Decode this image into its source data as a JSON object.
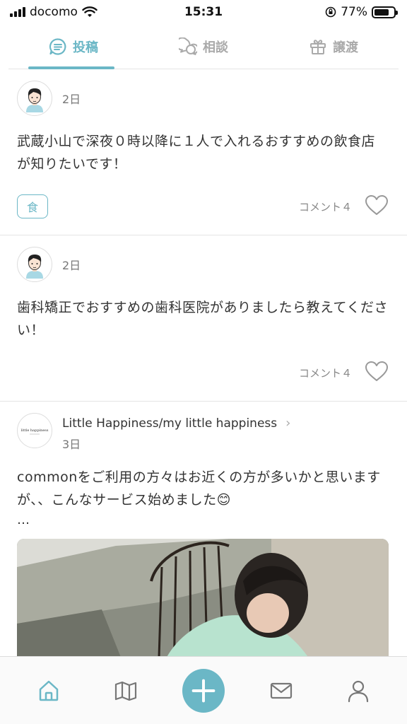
{
  "status_bar": {
    "carrier": "docomo",
    "time": "15:31",
    "battery": "77%",
    "battery_level": 0.77
  },
  "tabs": [
    {
      "label": "投稿",
      "icon": "chat-lines-icon",
      "active": true
    },
    {
      "label": "相談",
      "icon": "chat-bubbles-icon",
      "active": false
    },
    {
      "label": "譲渡",
      "icon": "gift-icon",
      "active": false
    }
  ],
  "posts": [
    {
      "date": "2日",
      "text": "武蔵小山で深夜０時以降に１人で入れるおすすめの飲食店が知りたいです！",
      "tag": "食",
      "comments": "コメント４",
      "liked": false
    },
    {
      "date": "2日",
      "text": "歯科矯正でおすすめの歯科医院がありましたら教えてください！",
      "comments": "コメント４",
      "liked": false
    }
  ],
  "store_post": {
    "name": "Little Happiness/my little happiness",
    "date": "3日",
    "text": "commonをご利用の方々はお近くの方が多いかと思いますが、、こんなサービス始めました😊",
    "more": "…",
    "logo_text": "little happiness"
  },
  "bottom_nav": [
    {
      "icon": "home-icon",
      "active": true
    },
    {
      "icon": "map-icon"
    },
    {
      "icon": "plus-icon"
    },
    {
      "icon": "mail-icon"
    },
    {
      "icon": "profile-icon"
    }
  ],
  "colors": {
    "accent": "#6bb7c6",
    "inactive": "#aaaaaa"
  }
}
